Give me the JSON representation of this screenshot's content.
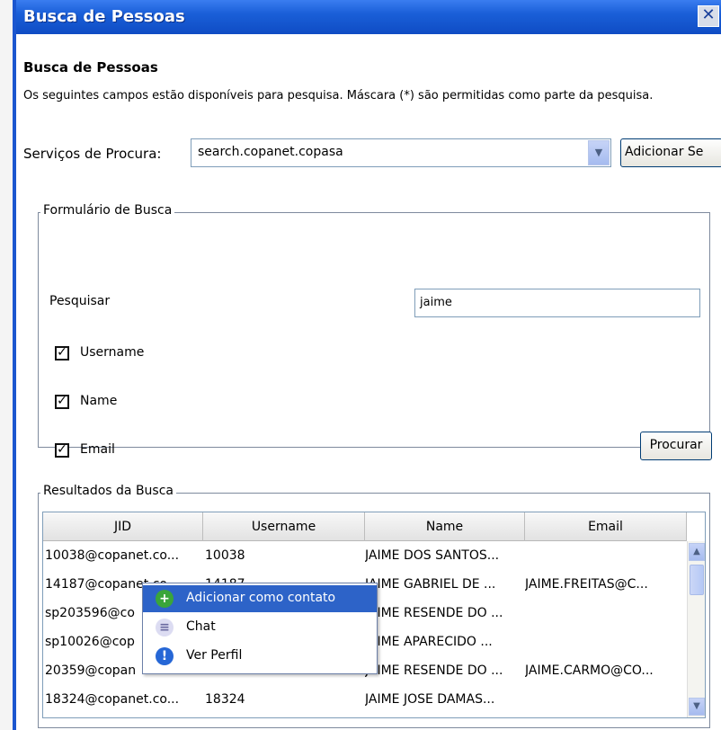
{
  "window": {
    "title": "Busca de Pessoas",
    "close_glyph": "✕"
  },
  "header": {
    "heading": "Busca de Pessoas",
    "description": "Os seguintes campos estão disponíveis para pesquisa. Máscara (*) são permitidas como parte da pesquisa."
  },
  "service": {
    "label": "Serviços de Procura:",
    "selected": "search.copanet.copasa",
    "add_button": "Adicionar Se"
  },
  "form": {
    "legend": "Formulário de Busca",
    "search_label": "Pesquisar",
    "search_value": "jaime",
    "checkboxes": [
      {
        "label": "Username",
        "checked": true
      },
      {
        "label": "Name",
        "checked": true
      },
      {
        "label": "Email",
        "checked": true
      }
    ],
    "search_button": "Procurar"
  },
  "results": {
    "legend": "Resultados da Busca",
    "columns": [
      "JID",
      "Username",
      "Name",
      "Email"
    ],
    "rows": [
      [
        "10038@copanet.co...",
        "10038",
        "JAIME DOS SANTOS...",
        ""
      ],
      [
        "14187@copanet.co...",
        "14187",
        "JAIME GABRIEL DE ...",
        "JAIME.FREITAS@C..."
      ],
      [
        "sp203596@co",
        "",
        "JAIME RESENDE DO ...",
        ""
      ],
      [
        "sp10026@cop",
        "",
        "JAIME APARECIDO ...",
        ""
      ],
      [
        "20359@copan",
        "",
        "JAIME RESENDE DO ...",
        "JAIME.CARMO@CO..."
      ],
      [
        "18324@copanet.co...",
        "18324",
        "JAIME JOSE DAMAS...",
        ""
      ]
    ]
  },
  "context_menu": {
    "items": [
      {
        "label": "Adicionar como contato",
        "icon": "add-contact-icon",
        "selected": true
      },
      {
        "label": "Chat",
        "icon": "chat-icon",
        "selected": false
      },
      {
        "label": "Ver Perfil",
        "icon": "info-icon",
        "selected": false
      }
    ]
  }
}
